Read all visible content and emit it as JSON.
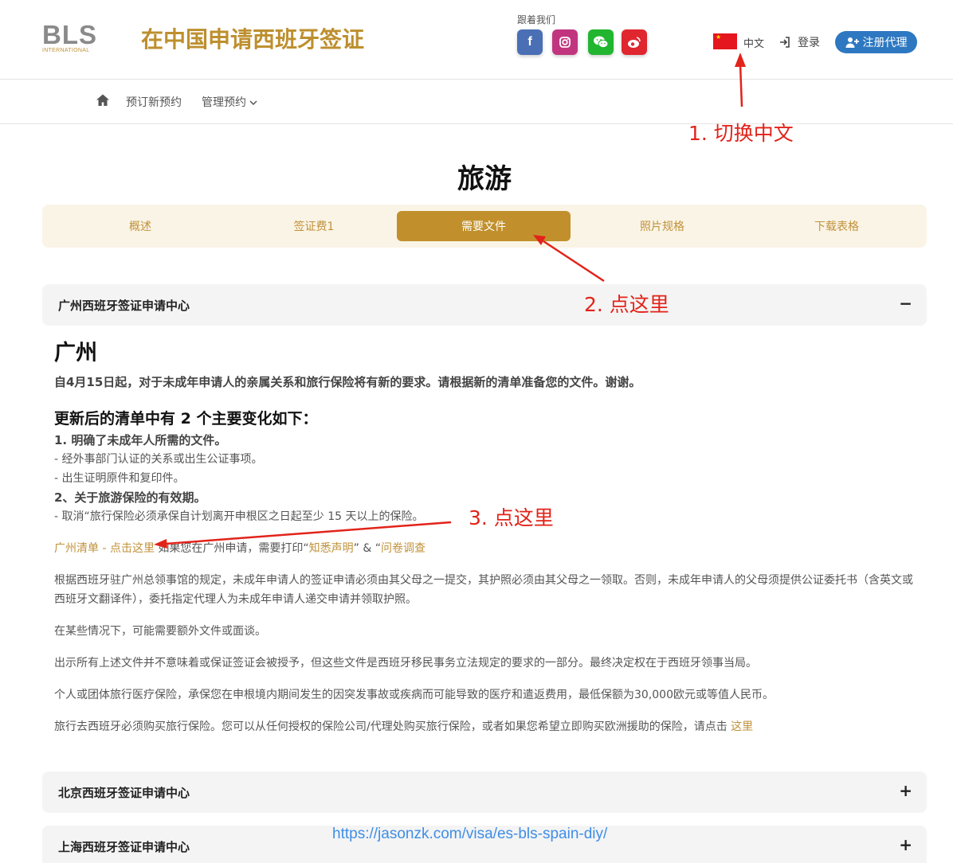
{
  "header": {
    "logo_text": "BLS",
    "logo_sub": "INTERNATIONAL",
    "site_title": "在中国申请西班牙签证",
    "follow_label": "跟着我们",
    "social_icons": [
      "facebook-icon",
      "instagram-icon",
      "wechat-icon",
      "weibo-icon"
    ],
    "language_label": "中文",
    "login_label": "登录",
    "register_label": "注册代理"
  },
  "nav": {
    "book_label": "预订新预约",
    "manage_label": "管理预约"
  },
  "annotations": {
    "step1": "1. 切换中文",
    "step2": "2. 点这里",
    "step3": "3. 点这里"
  },
  "page_title": "旅游",
  "tabs": [
    {
      "label": "概述"
    },
    {
      "label": "签证费1"
    },
    {
      "label": "需要文件",
      "active": true
    },
    {
      "label": "照片规格"
    },
    {
      "label": "下载表格"
    }
  ],
  "accordions": {
    "guangzhou": {
      "title": "广州西班牙签证申请中心",
      "toggle": "−"
    },
    "beijing": {
      "title": "北京西班牙签证申请中心",
      "toggle": "+"
    },
    "shanghai": {
      "title": "上海西班牙签证申请中心",
      "toggle": "+"
    }
  },
  "content": {
    "city": "广州",
    "notice": "自4月15日起，对于未成年申请人的亲属关系和旅行保险将有新的要求。请根据新的清单准备您的文件。谢谢。",
    "changes_title": "更新后的清单中有 2 个主要变化如下：",
    "change_1": "1. 明确了未成年人所需的文件。",
    "change_1a": "- 经外事部门认证的关系或出生公证事项。",
    "change_1b": "- 出生证明原件和复印件。",
    "change_2": "2、关于旅游保险的有效期。",
    "change_2a": "- 取消“旅行保险必须承保自计划离开申根区之日起至少 15 天以上的保险。",
    "checklist_link": "广州清单 - 点击这里",
    "checklist_text": " 如果您在广州申请，需要打印“",
    "declaration_link": "知悉声明",
    "amp_text": "” & “",
    "survey_link": "问卷调查",
    "para_minor": "根据西班牙驻广州总领事馆的规定，未成年申请人的签证申请必须由其父母之一提交，其护照必须由其父母之一领取。否则，未成年申请人的父母须提供公证委托书（含英文或西班牙文翻译件），委托指定代理人为未成年申请人递交申请并领取护照。",
    "para_extra": "在某些情况下，可能需要额外文件或面谈。",
    "para_decision": "出示所有上述文件并不意味着或保证签证会被授予，但这些文件是西班牙移民事务立法规定的要求的一部分。最终决定权在于西班牙领事当局。",
    "para_insurance": "个人或团体旅行医疗保险，承保您在申根境内期间发生的因突发事故或疾病而可能导致的医疗和遣返费用，最低保额为30,000欧元或等值人民币。",
    "para_buy": "旅行去西班牙必须购买旅行保险。您可以从任何授权的保险公司/代理处购买旅行保险，或者如果您希望立即购买欧洲援助的保险，请点击 ",
    "buy_link": "这里"
  },
  "watermark": "https://jasonzk.com/visa/es-bls-spain-diy/",
  "colors": {
    "gold": "#c1902c",
    "annotation_red": "#e2231a",
    "register_blue": "#2e78c2"
  }
}
